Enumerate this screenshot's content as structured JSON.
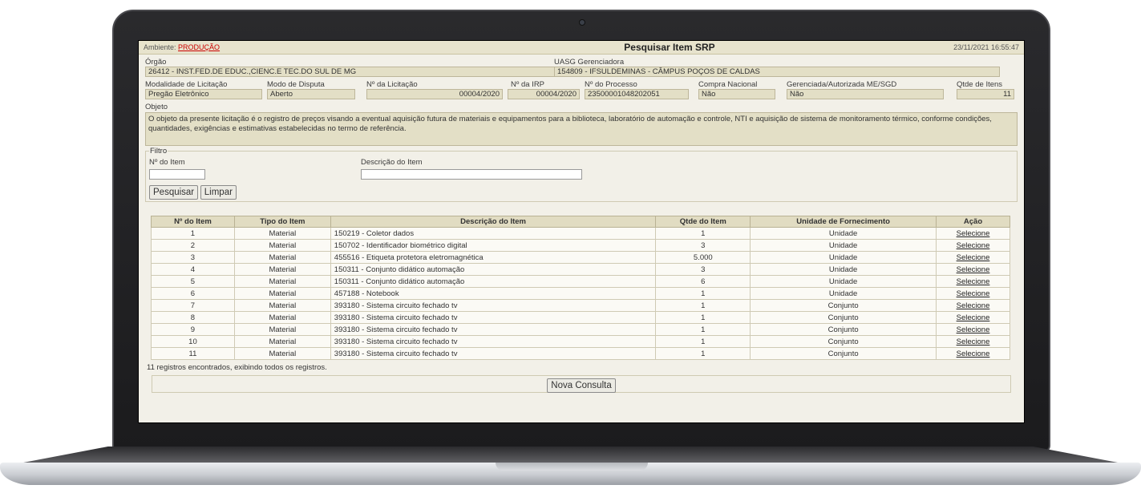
{
  "window": {
    "environment_label": "Ambiente:",
    "environment_value": "PRODUÇÃO",
    "title": "Pesquisar Item SRP",
    "timestamp": "23/11/2021 16:55:47"
  },
  "header": {
    "orgao_label": "Órgão",
    "orgao_value": "26412 - INST.FED.DE EDUC.,CIENC.E TEC.DO SUL DE MG",
    "uasg_label": "UASG Gerenciadora",
    "uasg_value": "154809 - IFSULDEMINAS - CÂMPUS POÇOS DE CALDAS",
    "modalidade_label": "Modalidade de Licitação",
    "modalidade_value": "Pregão Eletrônico",
    "modo_label": "Modo de Disputa",
    "modo_value": "Aberto",
    "licitacao_label": "Nº da Licitação",
    "licitacao_value": "00004/2020",
    "irp_label": "Nº da IRP",
    "irp_value": "00004/2020",
    "processo_label": "Nº do Processo",
    "processo_value": "23500001048202051",
    "compra_label": "Compra Nacional",
    "compra_value": "Não",
    "gerenciada_label": "Gerenciada/Autorizada ME/SGD",
    "gerenciada_value": "Não",
    "qtde_label": "Qtde de Itens",
    "qtde_value": "11",
    "objeto_label": "Objeto",
    "objeto_value": "O objeto da presente licitação é o registro de preços visando a eventual aquisição futura de materiais e equipamentos para a biblioteca, laboratório de automação e controle, NTI e aquisição de sistema de monitoramento térmico, conforme condições, quantidades, exigências e estimativas estabelecidas no termo de referência."
  },
  "filtro": {
    "legend": "Filtro",
    "item_label": "Nº do Item",
    "item_value": "",
    "desc_label": "Descrição do Item",
    "desc_value": "",
    "search_button": "Pesquisar",
    "clear_button": "Limpar"
  },
  "table": {
    "headers": [
      "Nº do Item",
      "Tipo do Item",
      "Descrição do Item",
      "Qtde do Item",
      "Unidade de Fornecimento",
      "Ação"
    ],
    "rows": [
      {
        "num": "1",
        "tipo": "Material",
        "desc": "150219 - Coletor dados",
        "qtde": "1",
        "unidade": "Unidade",
        "acao": "Selecione"
      },
      {
        "num": "2",
        "tipo": "Material",
        "desc": "150702 - Identificador biométrico digital",
        "qtde": "3",
        "unidade": "Unidade",
        "acao": "Selecione"
      },
      {
        "num": "3",
        "tipo": "Material",
        "desc": "455516 - Etiqueta protetora eletromagnética",
        "qtde": "5.000",
        "unidade": "Unidade",
        "acao": "Selecione"
      },
      {
        "num": "4",
        "tipo": "Material",
        "desc": "150311 - Conjunto didático automação",
        "qtde": "3",
        "unidade": "Unidade",
        "acao": "Selecione"
      },
      {
        "num": "5",
        "tipo": "Material",
        "desc": "150311 - Conjunto didático automação",
        "qtde": "6",
        "unidade": "Unidade",
        "acao": "Selecione"
      },
      {
        "num": "6",
        "tipo": "Material",
        "desc": "457188 - Notebook",
        "qtde": "1",
        "unidade": "Unidade",
        "acao": "Selecione"
      },
      {
        "num": "7",
        "tipo": "Material",
        "desc": "393180 - Sistema circuito fechado tv",
        "qtde": "1",
        "unidade": "Conjunto",
        "acao": "Selecione"
      },
      {
        "num": "8",
        "tipo": "Material",
        "desc": "393180 - Sistema circuito fechado tv",
        "qtde": "1",
        "unidade": "Conjunto",
        "acao": "Selecione"
      },
      {
        "num": "9",
        "tipo": "Material",
        "desc": "393180 - Sistema circuito fechado tv",
        "qtde": "1",
        "unidade": "Conjunto",
        "acao": "Selecione"
      },
      {
        "num": "10",
        "tipo": "Material",
        "desc": "393180 - Sistema circuito fechado tv",
        "qtde": "1",
        "unidade": "Conjunto",
        "acao": "Selecione"
      },
      {
        "num": "11",
        "tipo": "Material",
        "desc": "393180 - Sistema circuito fechado tv",
        "qtde": "1",
        "unidade": "Conjunto",
        "acao": "Selecione"
      }
    ]
  },
  "footer": {
    "records_text": "11 registros encontrados, exibindo todos os registros.",
    "new_query_button": "Nova Consulta"
  },
  "colors": {
    "accent_red": "#cc0000",
    "panel_beige": "#e3dfc6",
    "background": "#f2f0e8"
  }
}
